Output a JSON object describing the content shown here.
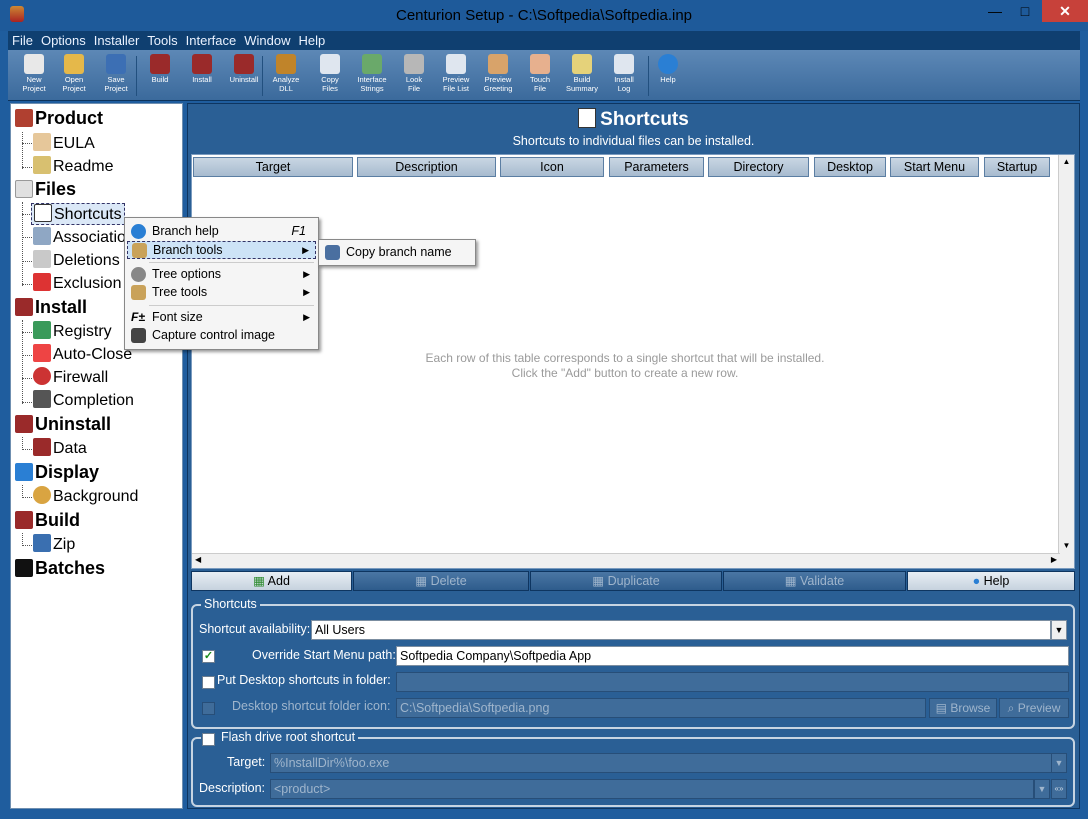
{
  "window": {
    "title": "Centurion Setup - C:\\Softpedia\\Softpedia.inp",
    "min": "—",
    "max": "□",
    "close": "✕"
  },
  "menu": [
    "File",
    "Options",
    "Installer",
    "Tools",
    "Interface",
    "Window",
    "Help"
  ],
  "toolbar": [
    {
      "l1": "New",
      "l2": "Project",
      "icon": "new-project-icon",
      "color": "#e8e8e8"
    },
    {
      "l1": "Open",
      "l2": "Project",
      "icon": "open-project-icon",
      "color": "#e5b84a"
    },
    {
      "l1": "Save",
      "l2": "Project",
      "icon": "save-project-icon",
      "color": "#3c6fb4"
    },
    {
      "l1": "Build",
      "l2": "",
      "icon": "build-icon",
      "color": "#9a2a2a"
    },
    {
      "l1": "Install",
      "l2": "",
      "icon": "install-icon",
      "color": "#9a2a2a"
    },
    {
      "l1": "Uninstall",
      "l2": "",
      "icon": "uninstall-icon",
      "color": "#9a2a2a"
    },
    {
      "l1": "Analyze",
      "l2": "DLL",
      "icon": "analyze-dll-icon",
      "color": "#c0842a"
    },
    {
      "l1": "Copy",
      "l2": "Files",
      "icon": "copy-files-icon",
      "color": "#dfe6ef"
    },
    {
      "l1": "Interface",
      "l2": "Strings",
      "icon": "interface-strings-icon",
      "color": "#6aa96a"
    },
    {
      "l1": "Look",
      "l2": "File",
      "icon": "look-file-icon",
      "color": "#b7b7b7"
    },
    {
      "l1": "Preview",
      "l2": "File List",
      "icon": "preview-file-list-icon",
      "color": "#dfe6ef"
    },
    {
      "l1": "Preview",
      "l2": "Greeting",
      "icon": "preview-greeting-icon",
      "color": "#d8a36a"
    },
    {
      "l1": "Touch",
      "l2": "File",
      "icon": "touch-file-icon",
      "color": "#e7b08e"
    },
    {
      "l1": "Build",
      "l2": "Summary",
      "icon": "build-summary-icon",
      "color": "#e5d27a"
    },
    {
      "l1": "Install",
      "l2": "Log",
      "icon": "install-log-icon",
      "color": "#dfe6ef"
    },
    {
      "l1": "Help",
      "l2": "",
      "icon": "help-icon",
      "color": "#2a7fd4"
    }
  ],
  "tree": {
    "product": "Product",
    "eula": "EULA",
    "readme": "Readme",
    "files": "Files",
    "shortcuts": "Shortcuts",
    "associations": "Associatio",
    "deletions": "Deletions",
    "exclusions": "Exclusion",
    "install": "Install",
    "registry": "Registry",
    "autoclose": "Auto-Close",
    "firewall": "Firewall",
    "completion": "Completion",
    "uninstall": "Uninstall",
    "data": "Data",
    "display": "Display",
    "background": "Background",
    "build": "Build",
    "zip": "Zip",
    "batches": "Batches"
  },
  "context_menu": {
    "branch_help": "Branch help",
    "branch_help_key": "F1",
    "branch_tools": "Branch tools",
    "tree_options": "Tree options",
    "tree_tools": "Tree tools",
    "font_size": "Font size",
    "capture": "Capture control image",
    "sub_copy": "Copy branch name"
  },
  "header": {
    "title": "Shortcuts",
    "subtitle": "Shortcuts to individual files can be installed."
  },
  "table": {
    "columns": [
      "Target",
      "Description",
      "Icon",
      "Parameters",
      "Directory",
      "Desktop",
      "Start Menu",
      "Startup"
    ],
    "empty1": "Each row of this table corresponds to a single shortcut that will be installed.",
    "empty2": "Click the \"Add\" button to create a new row."
  },
  "actions": {
    "add": "Add",
    "delete": "Delete",
    "duplicate": "Duplicate",
    "validate": "Validate",
    "help": "Help"
  },
  "shortcuts_group": {
    "legend": "Shortcuts",
    "availability_label": "Shortcut availability:",
    "availability_value": "All Users",
    "override_label": "Override Start Menu path:",
    "override_value": "Softpedia Company\\Softpedia App",
    "desktop_label": "Put Desktop shortcuts in folder:",
    "desktop_value": "",
    "folder_icon_label": "Desktop shortcut folder icon:",
    "folder_icon_value": "C:\\Softpedia\\Softpedia.png",
    "browse": "Browse",
    "preview": "Preview"
  },
  "flash_group": {
    "legend": "Flash drive root shortcut",
    "target_label": "Target:",
    "target_value": "%InstallDir%\\foo.exe",
    "desc_label": "Description:",
    "desc_value": "<product>"
  }
}
